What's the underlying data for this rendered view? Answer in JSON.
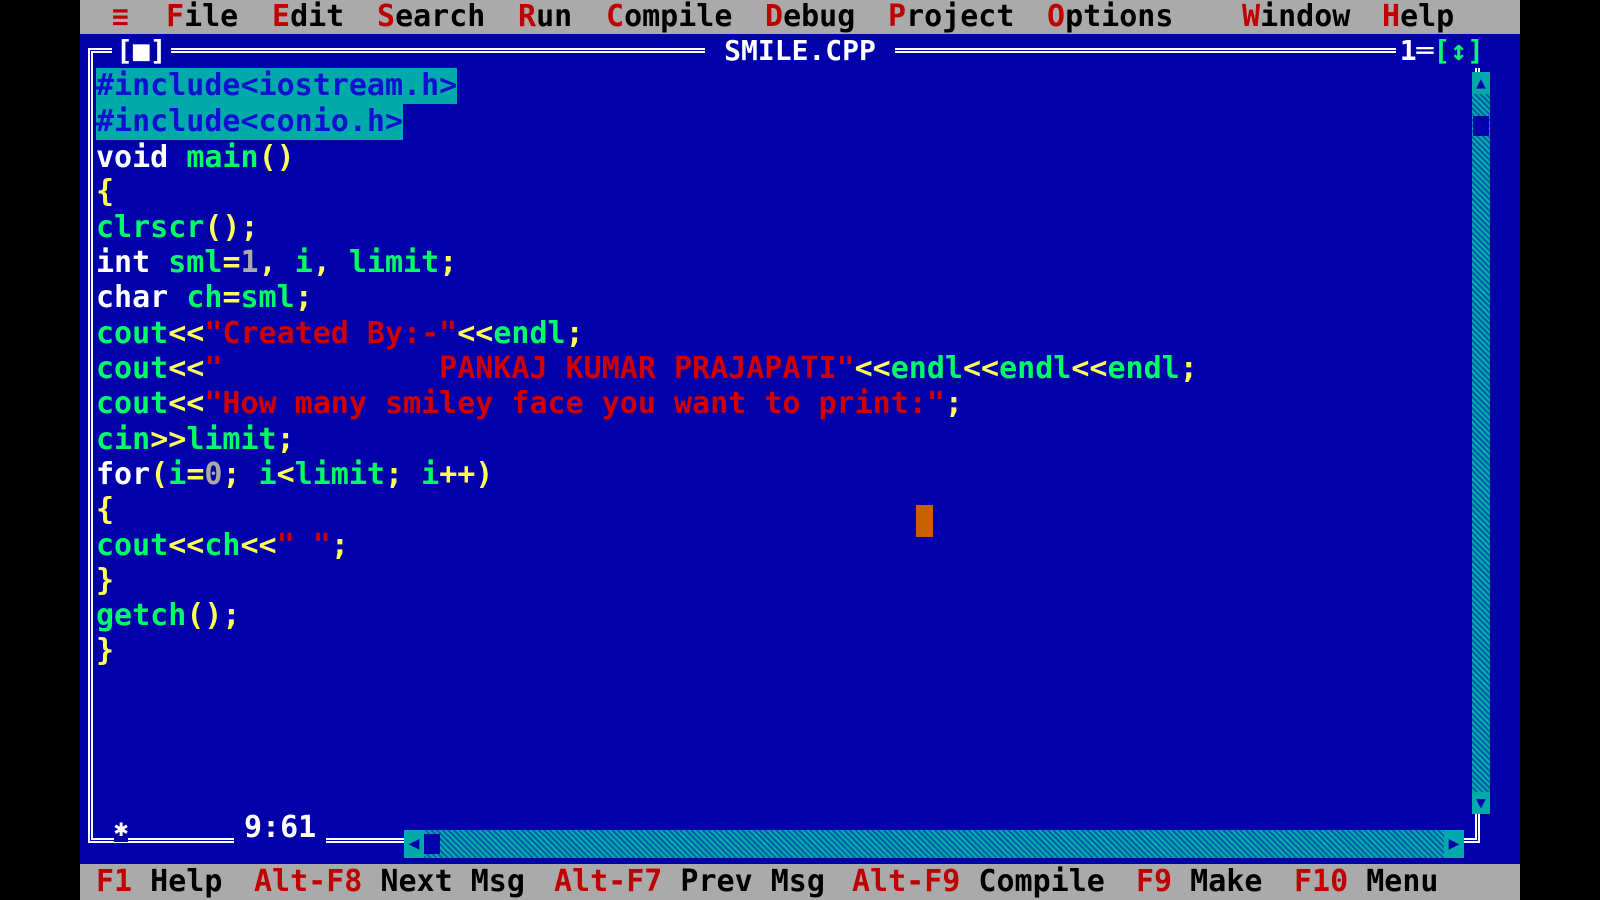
{
  "menubar": {
    "system_icon": "≡",
    "items": [
      {
        "hot": "F",
        "rest": "ile"
      },
      {
        "hot": "E",
        "rest": "dit"
      },
      {
        "hot": "S",
        "rest": "earch"
      },
      {
        "hot": "R",
        "rest": "un"
      },
      {
        "hot": "C",
        "rest": "ompile"
      },
      {
        "hot": "D",
        "rest": "ebug"
      },
      {
        "hot": "P",
        "rest": "roject"
      },
      {
        "hot": "O",
        "rest": "ptions"
      },
      {
        "hot": "W",
        "rest": "indow"
      },
      {
        "hot": "H",
        "rest": "elp"
      }
    ]
  },
  "window": {
    "title": "SMILE.CPP",
    "close_box": "[■]",
    "number": "1",
    "zoom_box": "[↕]",
    "cursor_position": "9:61",
    "resize_icon": "✱"
  },
  "code": [
    "#include<iostream.h>",
    "#include<conio.h>",
    "void main()",
    "{",
    "clrscr();",
    "int sml=1, i, limit;",
    "char ch=sml;",
    "cout<<\"Created By:-\"<<endl;",
    "cout<<\"            PANKAJ KUMAR PRAJAPATI\"<<endl<<endl<<endl;",
    "cout<<\"How many smiley face you want to print:\";",
    "cin>>limit;",
    "for(i=0; i<limit; i++)",
    "{",
    "cout<<ch<<\" \";",
    "}",
    "getch();",
    "}"
  ],
  "statusbar": [
    {
      "key": "F1",
      "label": " Help"
    },
    {
      "key": "Alt-F8",
      "label": " Next Msg"
    },
    {
      "key": "Alt-F7",
      "label": " Prev Msg"
    },
    {
      "key": "Alt-F9",
      "label": " Compile"
    },
    {
      "key": "F9",
      "label": " Make"
    },
    {
      "key": "F10",
      "label": " Menu"
    }
  ],
  "colors": {
    "background": "#0000aa",
    "menu": "#aaaaaa",
    "hotkey": "#c00000",
    "identifier": "#00ff66",
    "symbol": "#ffff55",
    "string": "#d00000",
    "cursor": "#c86000"
  }
}
